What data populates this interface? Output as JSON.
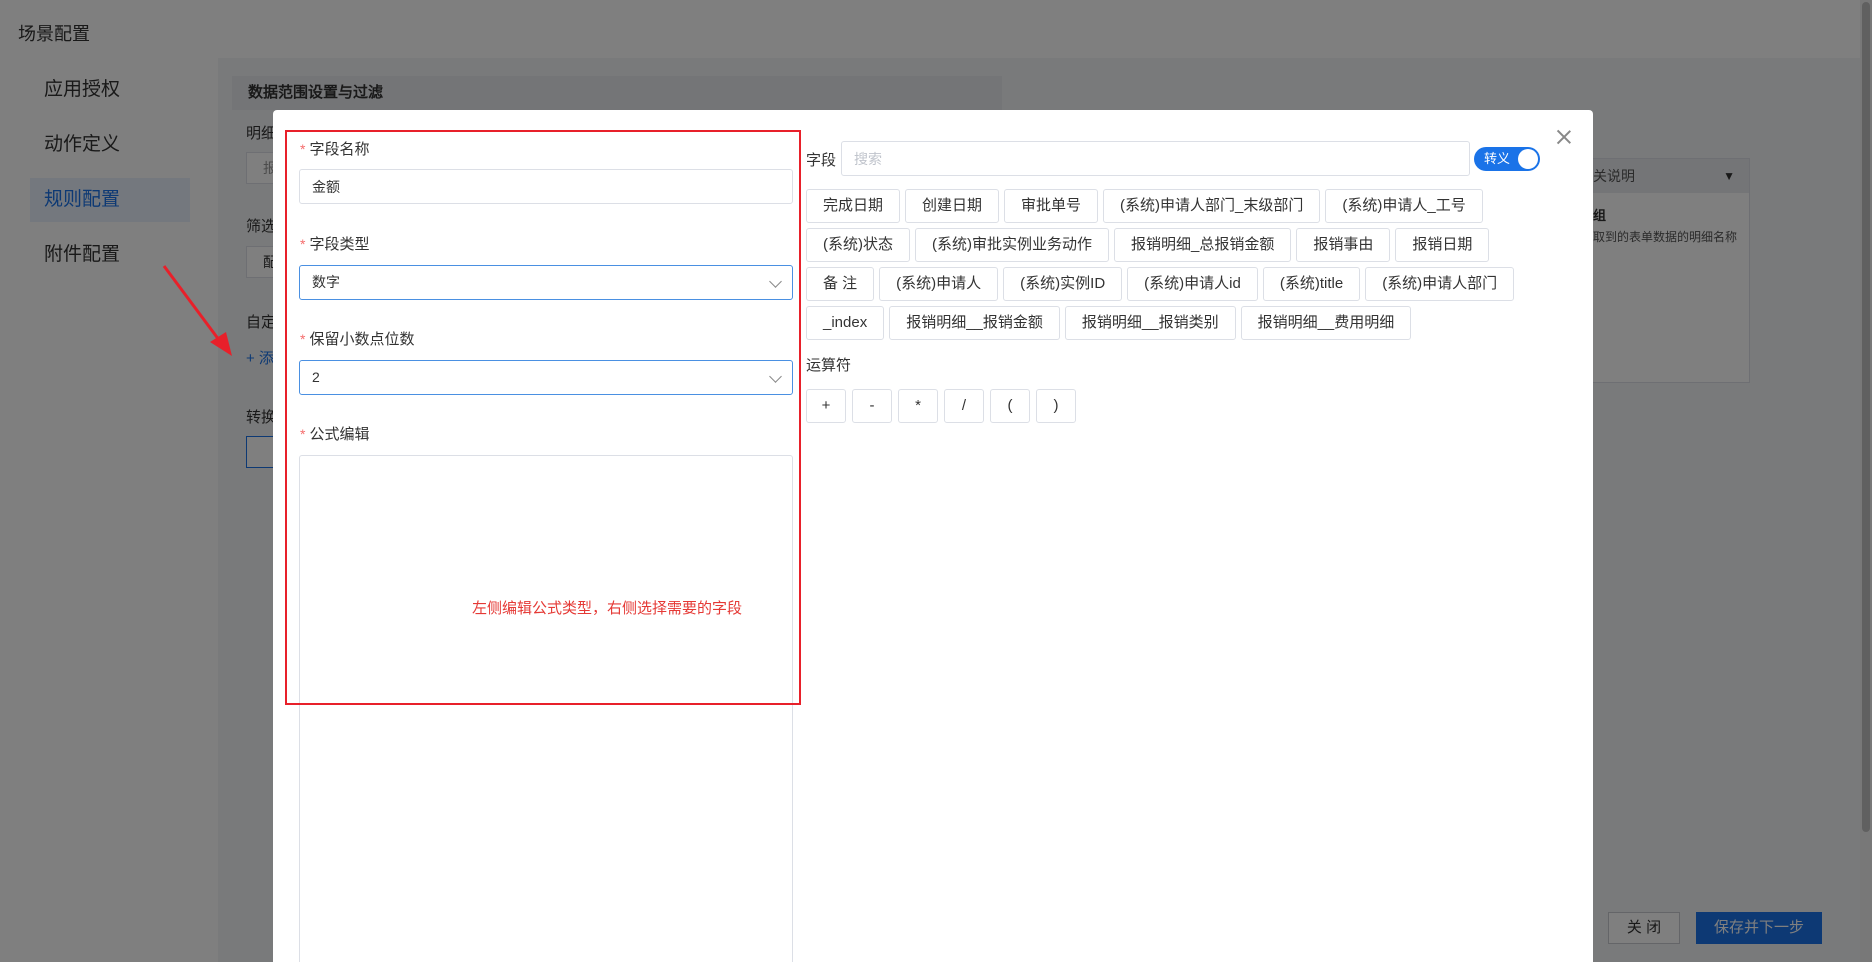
{
  "page": {
    "title": "场景配置"
  },
  "sidebar": {
    "items": [
      {
        "label": "应用授权",
        "active": false
      },
      {
        "label": "动作定义",
        "active": false
      },
      {
        "label": "规则配置",
        "active": true
      },
      {
        "label": "附件配置",
        "active": false
      }
    ]
  },
  "background": {
    "section_title": "数据范围设置与过滤",
    "labels": [
      "明细",
      "筛选",
      "自定",
      "转换"
    ],
    "box_texts": [
      "报",
      "配"
    ],
    "add_text": "+ 添",
    "right_panel": {
      "header": "关说明",
      "title": "组",
      "text": "取到的表单数据的明细名称"
    },
    "buttons": {
      "close": "关 闭",
      "next": "保存并下一步"
    }
  },
  "modal": {
    "form": {
      "field_name": {
        "label": "字段名称",
        "value": "金额"
      },
      "field_type": {
        "label": "字段类型",
        "value": "数字"
      },
      "decimal_places": {
        "label": "保留小数点位数",
        "value": "2"
      },
      "formula": {
        "label": "公式编辑",
        "value": ""
      }
    },
    "annotation": "左侧编辑公式类型，右侧选择需要的字段",
    "fields": {
      "label": "字段",
      "search_placeholder": "搜索",
      "toggle_label": "转义",
      "toggle_on": true,
      "chip_rows": [
        [
          "完成日期",
          "创建日期",
          "审批单号",
          "(系统)申请人部门_末级部门",
          "(系统)申请人_工号"
        ],
        [
          "(系统)状态",
          "(系统)审批实例业务动作",
          "报销明细_总报销金额",
          "报销事由",
          "报销日期"
        ],
        [
          "备 注",
          "(系统)申请人",
          "(系统)实例ID",
          "(系统)申请人id",
          "(系统)title",
          "(系统)申请人部门"
        ],
        [
          "_index",
          "报销明细__报销金额",
          "报销明细__报销类别",
          "报销明细__费用明细"
        ]
      ]
    },
    "operators": {
      "label": "运算符",
      "items": [
        "+",
        "-",
        "*",
        "/",
        "(",
        ")"
      ]
    }
  },
  "colors": {
    "accent": "#1a73e8",
    "annotation_red": "#e8202a",
    "required": "#f56c6c"
  }
}
